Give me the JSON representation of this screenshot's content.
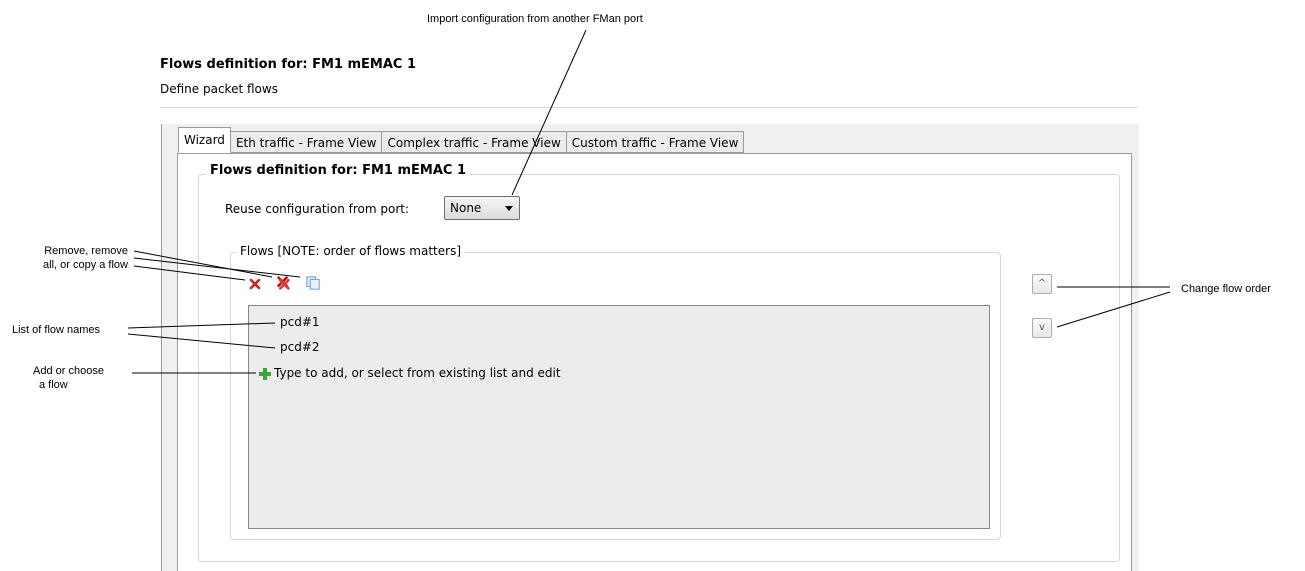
{
  "annotations": {
    "import_config": "Import configuration from another FMan port",
    "remove_line1": "Remove, remove",
    "remove_line2": "all, or copy a flow",
    "list_names": "List of flow names",
    "add_line1": "Add or choose",
    "add_line2": "a flow",
    "change_order": "Change flow order"
  },
  "page": {
    "title": "Flows definition for: FM1 mEMAC 1",
    "subtitle": "Define packet flows"
  },
  "tabs": [
    {
      "label": "Wizard",
      "active": true
    },
    {
      "label": "Eth traffic - Frame View",
      "active": false
    },
    {
      "label": "Complex traffic - Frame View",
      "active": false
    },
    {
      "label": "Custom traffic - Frame View",
      "active": false
    }
  ],
  "wizard": {
    "group_title": "Flows definition for: FM1 mEMAC 1",
    "reuse_label": "Reuse configuration from port:",
    "reuse_value": "None",
    "flows_group_title": "Flows [NOTE: order of flows matters]",
    "flows": [
      "pcd#1",
      "pcd#2"
    ],
    "add_placeholder": "Type to add, or select from existing list and edit",
    "move_up": "^",
    "move_down": "v"
  },
  "icons": {
    "remove": "remove-icon",
    "remove_all": "remove-all-icon",
    "copy": "copy-icon",
    "add": "add-icon"
  },
  "colors": {
    "remove_red": "#d42020",
    "add_green": "#3aa63a",
    "copy_blue": "#7aa7d8"
  }
}
